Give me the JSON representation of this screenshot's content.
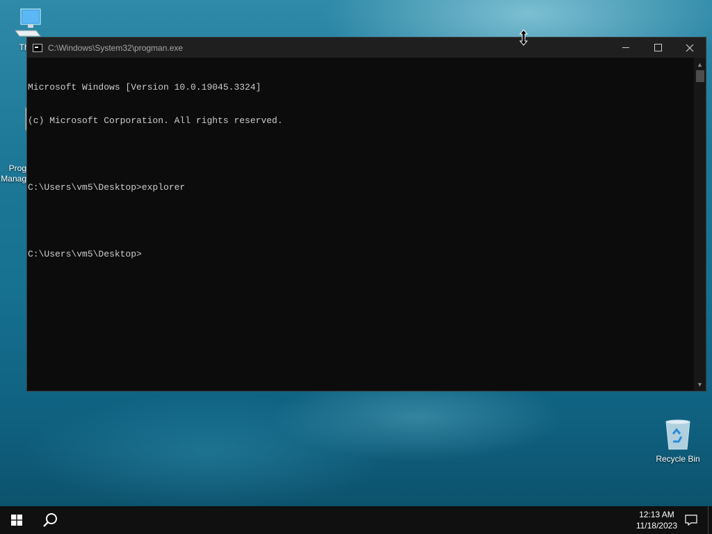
{
  "desktop": {
    "icons": [
      {
        "label": "This"
      },
      {
        "label": "Prog\nManag"
      },
      {
        "label": "Recycle Bin"
      }
    ]
  },
  "window": {
    "title": "C:\\Windows\\System32\\progman.exe",
    "console_lines": [
      "Microsoft Windows [Version 10.0.19045.3324]",
      "(c) Microsoft Corporation. All rights reserved.",
      "",
      "C:\\Users\\vm5\\Desktop>explorer",
      "",
      "C:\\Users\\vm5\\Desktop>"
    ]
  },
  "taskbar": {
    "time": "12:13 AM",
    "date": "11/18/2023"
  },
  "colors": {
    "console_bg": "#0c0c0c",
    "console_text": "#cccccc",
    "titlebar": "#1f1f1f",
    "taskbar": "#101010"
  }
}
